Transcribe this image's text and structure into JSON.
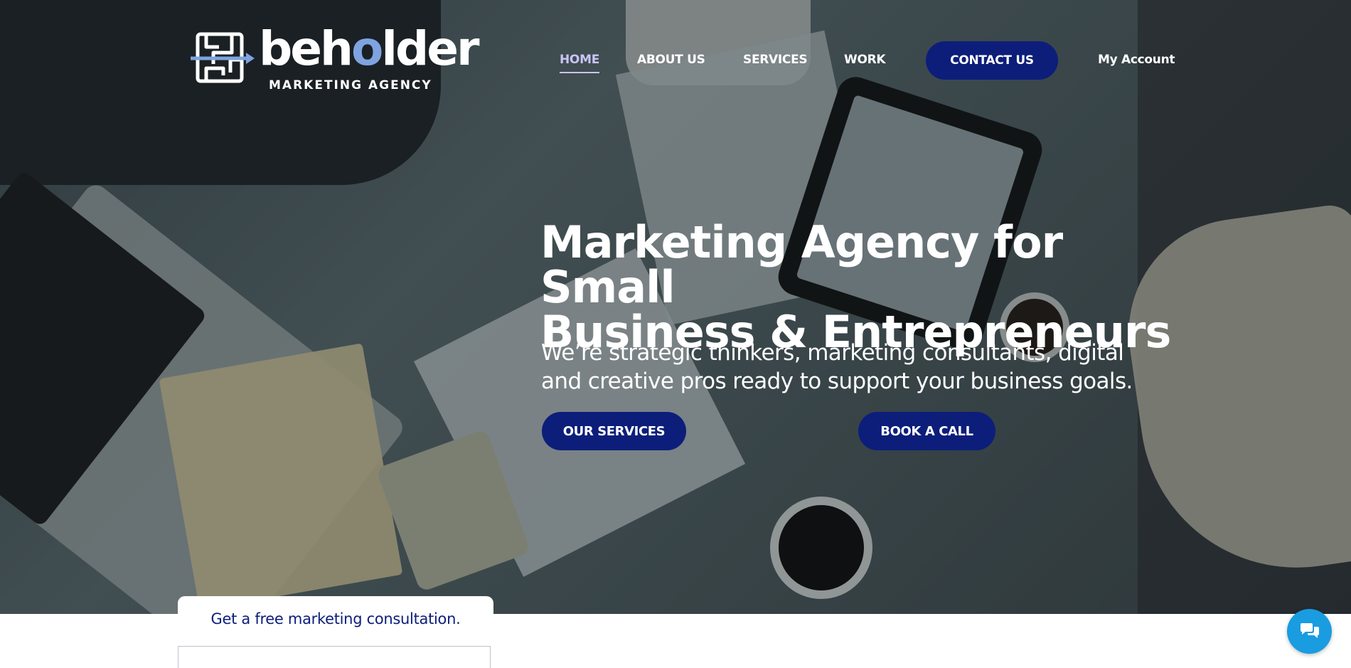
{
  "brand": {
    "name": "beholder",
    "tagline": "MARKETING AGENCY",
    "logo_icon": "maze-arrow-logo",
    "accent_color": "#0c1e7a",
    "logo_o_color": "#7ea3e0"
  },
  "nav": {
    "items": [
      {
        "label": "HOME",
        "active": true
      },
      {
        "label": "ABOUT US",
        "active": false
      },
      {
        "label": "SERVICES",
        "active": false
      },
      {
        "label": "WORK",
        "active": false
      }
    ],
    "contact_label": "CONTACT US",
    "account_label": "My Account"
  },
  "hero": {
    "headline_line1": "Marketing Agency for Small",
    "headline_line2": "Business & Entrepreneurs",
    "subhead_line1": "We’re strategic thinkers, marketing consultants, digital",
    "subhead_line2": "and creative pros ready to support your business goals.",
    "primary_cta": "OUR SERVICES",
    "secondary_cta": "BOOK A CALL",
    "background": "office-meeting-photo"
  },
  "consultation": {
    "title": "Get a free marketing consultation."
  },
  "chat": {
    "icon": "chat-bubbles-icon",
    "color": "#1a9ce0"
  }
}
